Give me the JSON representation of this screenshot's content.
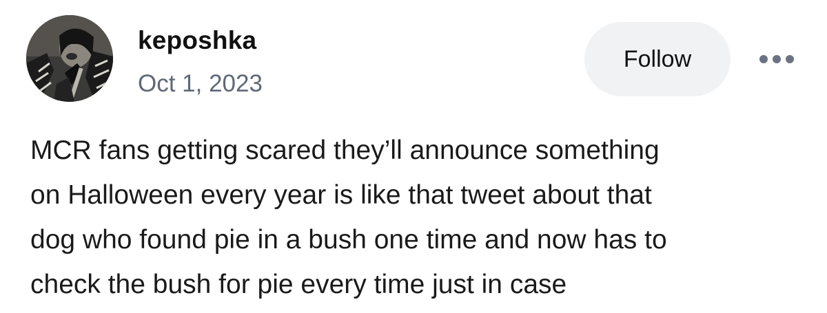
{
  "post": {
    "author": {
      "username": "keposhka",
      "avatar_icon": "profile-photo"
    },
    "date": "Oct 1, 2023",
    "follow_label": "Follow",
    "more_icon": "more-horizontal-icon",
    "body_lines": [
      "MCR fans getting scared they’ll announce something",
      "on Halloween every year is like that tweet about that",
      "dog who found pie in a bush one time and now has to",
      "check the bush for pie every time just in case"
    ]
  },
  "colors": {
    "background": "#ffffff",
    "text": "#1a1a1a",
    "date": "#5f6877",
    "follow_bg": "#f1f2f4",
    "more_dots": "#6b7382"
  }
}
